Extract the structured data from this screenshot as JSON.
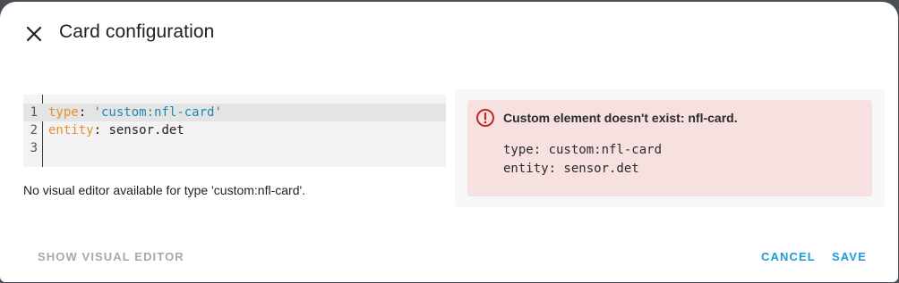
{
  "dialog": {
    "title": "Card configuration",
    "close_icon": "close-icon"
  },
  "editor": {
    "lines": [
      {
        "num": "1",
        "key": "type",
        "sep": ": ",
        "value": "'custom:nfl-card'",
        "value_kind": "string"
      },
      {
        "num": "2",
        "key": "entity",
        "sep": ": ",
        "value": "sensor.det",
        "value_kind": "plain"
      },
      {
        "num": "3",
        "key": "",
        "sep": "",
        "value": "",
        "value_kind": "plain"
      }
    ],
    "active_line": 1
  },
  "hint": "No visual editor available for type 'custom:nfl-card'.",
  "preview": {
    "error_icon": "alert-circle-icon",
    "error_title": "Custom element doesn't exist: nfl-card.",
    "yaml_lines": [
      "type: custom:nfl-card",
      "entity: sensor.det"
    ]
  },
  "footer": {
    "show_visual_editor": "SHOW VISUAL EDITOR",
    "cancel": "CANCEL",
    "save": "SAVE"
  },
  "colors": {
    "accent": "#1d9bd6",
    "error_background": "#f6e0e0",
    "error_icon": "#c62828",
    "yaml_key": "#e5912e",
    "yaml_string": "#1e88b4"
  }
}
